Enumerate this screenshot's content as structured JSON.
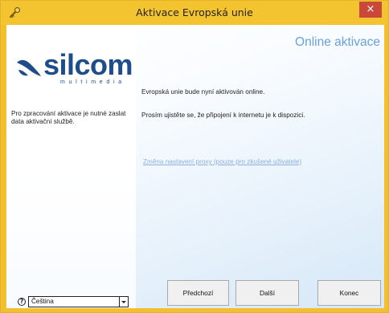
{
  "window": {
    "title": "Aktivace Evropská unie",
    "close_label": "×"
  },
  "logo": {
    "name": "silcom",
    "subtitle": "multimedia",
    "accent_color": "#1f4d8c"
  },
  "sidebar": {
    "info_text": "Pro zpracování aktivace je nutné zaslat data aktivační službě."
  },
  "main": {
    "heading": "Online aktivace",
    "message_1": "Evropská unie bude nyní aktivován online.",
    "message_2": "Prosím ujistěte se, že připojení k internetu je k dispozici.",
    "proxy_link": "Změna nastavení proxy (pouze pro zkušené uživatele)"
  },
  "buttons": {
    "prev": "Předchozí",
    "next": "Další",
    "end": "Konec"
  },
  "language": {
    "selected": "Čeština"
  },
  "icons": {
    "title": "key-icon",
    "help": "help-icon",
    "dropdown": "chevron-down-icon",
    "logo": "swoosh-icon"
  }
}
